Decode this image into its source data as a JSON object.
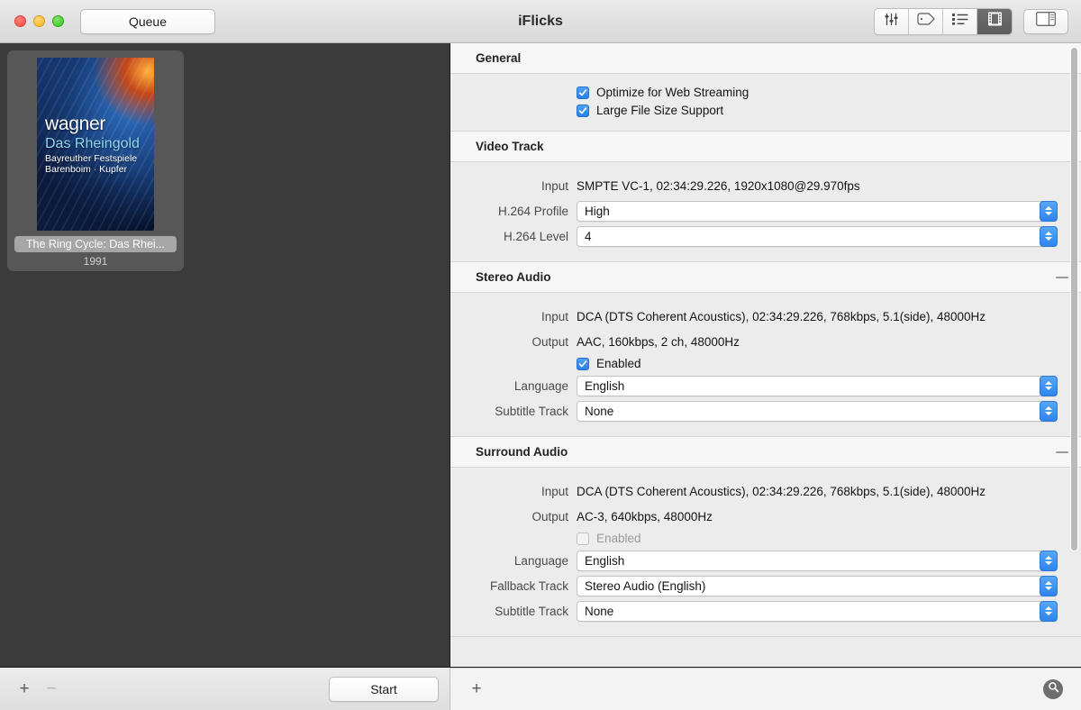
{
  "window": {
    "title": "iFlicks",
    "queue_button": "Queue",
    "traffic_lights": [
      "close-button",
      "minimize-button",
      "zoom-button"
    ]
  },
  "toolbar": {
    "segments": [
      {
        "name": "adjustments-icon",
        "label": "Adjustments",
        "selected": false
      },
      {
        "name": "tag-icon",
        "label": "Metadata",
        "selected": false
      },
      {
        "name": "list-icon",
        "label": "List View",
        "selected": false
      },
      {
        "name": "film-strip-icon",
        "label": "Video",
        "selected": true
      }
    ],
    "sidebar_toggle": {
      "name": "sidebar-panel-icon",
      "label": "Toggle Sidebar"
    }
  },
  "sidebar": {
    "items": [
      {
        "title": "The Ring Cycle: Das Rhei...",
        "year": "1991",
        "selected": true,
        "cover": {
          "artist": "wagner",
          "title": "Das Rheingold",
          "line1": "Bayreuther Festspiele",
          "line2": "Barenboim · Kupfer"
        }
      }
    ]
  },
  "inspector": {
    "sections": [
      {
        "name": "general",
        "header": "General",
        "collapsible": false,
        "checkboxes": [
          {
            "label": "Optimize for Web Streaming",
            "checked": true,
            "enabled": true
          },
          {
            "label": "Large File Size Support",
            "checked": true,
            "enabled": true
          }
        ]
      },
      {
        "name": "video-track",
        "header": "Video Track",
        "collapsible": false,
        "rows": [
          {
            "type": "text",
            "label": "Input",
            "value": "SMPTE VC-1, 02:34:29.226, 1920x1080@29.970fps"
          },
          {
            "type": "select",
            "label": "H.264 Profile",
            "value": "High"
          },
          {
            "type": "select",
            "label": "H.264 Level",
            "value": "4"
          }
        ]
      },
      {
        "name": "stereo-audio",
        "header": "Stereo Audio",
        "collapsible": true,
        "rows": [
          {
            "type": "text",
            "label": "Input",
            "value": "DCA (DTS Coherent Acoustics), 02:34:29.226, 768kbps, 5.1(side), 48000Hz"
          },
          {
            "type": "text",
            "label": "Output",
            "value": "AAC, 160kbps, 2 ch, 48000Hz"
          },
          {
            "type": "checkbox",
            "label": "Enabled",
            "checked": true,
            "enabled": true
          },
          {
            "type": "select",
            "label": "Language",
            "value": "English"
          },
          {
            "type": "select",
            "label": "Subtitle Track",
            "value": "None"
          }
        ]
      },
      {
        "name": "surround-audio",
        "header": "Surround Audio",
        "collapsible": true,
        "rows": [
          {
            "type": "text",
            "label": "Input",
            "value": "DCA (DTS Coherent Acoustics), 02:34:29.226, 768kbps, 5.1(side), 48000Hz"
          },
          {
            "type": "text",
            "label": "Output",
            "value": "AC-3, 640kbps, 48000Hz"
          },
          {
            "type": "checkbox",
            "label": "Enabled",
            "checked": false,
            "enabled": false
          },
          {
            "type": "select",
            "label": "Language",
            "value": "English"
          },
          {
            "type": "select",
            "label": "Fallback Track",
            "value": "Stereo Audio (English)"
          },
          {
            "type": "select",
            "label": "Subtitle Track",
            "value": "None"
          }
        ]
      }
    ]
  },
  "bottom_bar": {
    "add_label": "+",
    "remove_label": "−",
    "remove_enabled": false,
    "start_label": "Start",
    "inspector_add_label": "+",
    "search_icon": "search-icon"
  },
  "colors": {
    "accent_blue": "#2f85ed",
    "checkbox_blue": "#2b7fe9",
    "sidebar_bg": "#3b3b3b",
    "selection_bg": "#575757",
    "section_header_bg": "#f6f6f6",
    "panel_bg": "#ececec"
  }
}
